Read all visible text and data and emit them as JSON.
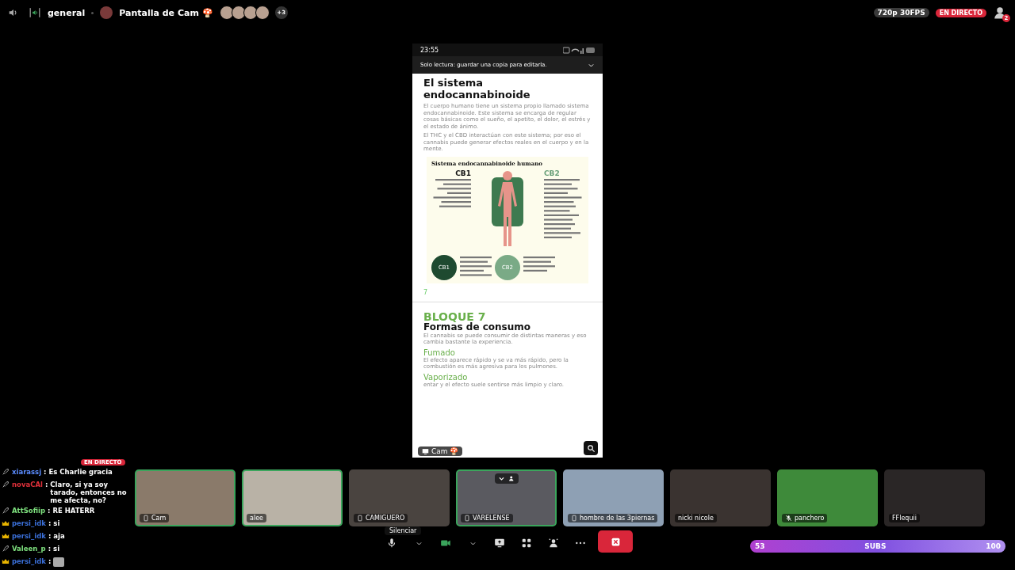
{
  "top_bar": {
    "channel": "general",
    "stream_title": "Pantalla de Cam 🍄",
    "viewer_more": "+3",
    "quality": "720p 30FPS",
    "live_badge": "EN DIRECTO",
    "notification_count": "2"
  },
  "phone": {
    "time": "23:55",
    "banner": "Solo lectura: guardar una copia para editarla.",
    "heading": "El sistema endocannabinoide",
    "paragraphs": [
      "El cuerpo humano tiene un sistema propio llamado sistema endocannabinoide. Este sistema se encarga de regular cosas básicas como el sueño, el apetito, el dolor, el estrés y el estado de ánimo.",
      "El THC y el CBD interactúan con este sistema; por eso el cannabis puede generar efectos reales en el cuerpo y en la mente."
    ],
    "infographic": {
      "title": "Sistema endocannabinoide humano",
      "left_label": "CB1",
      "right_label": "CB2",
      "left_circle": "CB1",
      "right_circle": "CB2"
    },
    "page_number": "7",
    "block_label": "BLOQUE 7",
    "block_title": "Formas de consumo",
    "block_intro": "El cannabis se puede consumir de distintas maneras y eso cambia bastante la experiencia.",
    "sections": [
      {
        "title": "Fumado",
        "text": "El efecto aparece rápido y se va más rápido, pero la combustión es más agresiva para los pulmones."
      },
      {
        "title": "Vaporizado",
        "text": "entar y el efecto suele sentirse más limpio y claro."
      }
    ],
    "stream_label": "Cam 🍄"
  },
  "chat": {
    "live_badge": "EN DIRECTO",
    "messages": [
      {
        "kind": "sub",
        "user": "xiarassj",
        "separator": ":",
        "color": "#5b8cff",
        "text": "Es Charlie gracia"
      },
      {
        "kind": "sub",
        "user": "novaCAl",
        "separator": ":",
        "color": "#e0303a",
        "text": "Claro, si ya soy tarado, entonces no me afecta, no?"
      },
      {
        "kind": "sub",
        "user": "AttSofiip",
        "separator": ":",
        "color": "#7ee07e",
        "text": "RE HATERR"
      },
      {
        "kind": "crown",
        "user": "persi_idk",
        "separator": ":",
        "color": "#3a6fd8",
        "text": "si"
      },
      {
        "kind": "crown",
        "user": "persi_idk",
        "separator": ":",
        "color": "#3a6fd8",
        "text": "aja"
      },
      {
        "kind": "sub",
        "user": "Valeen_p",
        "separator": ":",
        "color": "#7ee07e",
        "text": "si"
      },
      {
        "kind": "crown",
        "user": "persi_idk",
        "separator": ":",
        "color": "#3a6fd8"
      }
    ]
  },
  "tiles": [
    {
      "name": "Cam",
      "kind": "phone",
      "speaking": true
    },
    {
      "name": "alee",
      "kind": "plain",
      "speaking": true
    },
    {
      "name": "CAMIGUERO",
      "kind": "phone",
      "speaking": false
    },
    {
      "name": "VARELENSE",
      "kind": "phone",
      "speaking": true
    },
    {
      "name": "hombre de las 3piernas",
      "kind": "phone",
      "speaking": false
    },
    {
      "name": "nicki nicole",
      "kind": "plain",
      "speaking": false
    },
    {
      "name": "panchero",
      "kind": "muted",
      "speaking": false
    },
    {
      "name": "FFlequii",
      "kind": "plain",
      "speaking": false
    }
  ],
  "controls": {
    "tooltip": "Silenciar"
  },
  "sub_goal": {
    "count": "53",
    "label": "SUBS",
    "max": "100"
  }
}
